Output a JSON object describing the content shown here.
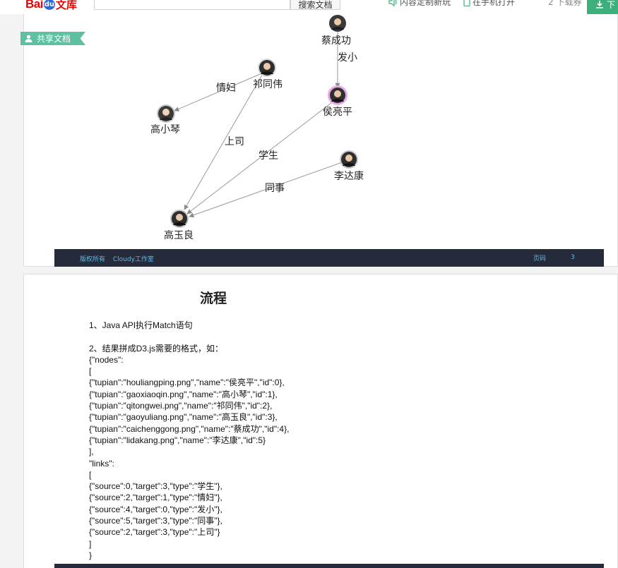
{
  "header": {
    "logo_bai": "Bai",
    "logo_du": "du",
    "logo_wenku": "文库",
    "search_button": "搜索文档",
    "nav_custom": "内容定制新玩",
    "nav_phone": "在手机打开",
    "download_count": "2 下载券",
    "download_button": "下"
  },
  "share_tag": "共享文档",
  "graph": {
    "nodes": [
      {
        "name": "蔡成功"
      },
      {
        "name": "祁同伟"
      },
      {
        "name": "侯亮平"
      },
      {
        "name": "高小琴"
      },
      {
        "name": "李达康"
      },
      {
        "name": "高玉良"
      }
    ],
    "links": [
      {
        "label": "发小"
      },
      {
        "label": "情妇"
      },
      {
        "label": "学生"
      },
      {
        "label": "上司"
      },
      {
        "label": "同事"
      }
    ]
  },
  "footer": {
    "copyright": "版权所有",
    "studio": "Cloudy工作室",
    "page_label": "页码",
    "page_number": "3"
  },
  "doc": {
    "title": "流程",
    "lines": [
      "1、Java API执行Match语句",
      "",
      "2、结果拼成D3.js需要的格式，如：",
      "{\"nodes\":",
      "[",
      "{\"tupian\":\"houliangping.png\",\"name\":\"侯亮平\",\"id\":0},",
      "{\"tupian\":\"gaoxiaoqin.png\",\"name\":\"高小琴\",\"id\":1},",
      "{\"tupian\":\"qitongwei.png\",\"name\":\"祁同伟\",\"id\":2},",
      "{\"tupian\":\"gaoyuliang.png\",\"name\":\"高玉良\",\"id\":3},",
      "{\"tupian\":\"caichenggong.png\",\"name\":\"蔡成功\",\"id\":4},",
      "{\"tupian\":\"lidakang.png\",\"name\":\"李达康\",\"id\":5}",
      "],",
      "\"links\":",
      "[",
      "{\"source\":0,\"target\":3,\"type\":\"学生\"},",
      "{\"source\":2,\"target\":1,\"type\":\"情妇\"},",
      "{\"source\":4,\"target\":0,\"type\":\"发小\"},",
      "{\"source\":5,\"target\":3,\"type\":\"同事\"},",
      "{\"source\":2,\"target\":3,\"type\":\"上司\"}",
      "]",
      "}"
    ]
  },
  "colors": {
    "accent_green": "#3daf7b",
    "share_tag": "#5ec0a0",
    "footer_bg": "#252b3b",
    "footer_text": "#5fb9e6",
    "logo_red": "#e10602"
  }
}
